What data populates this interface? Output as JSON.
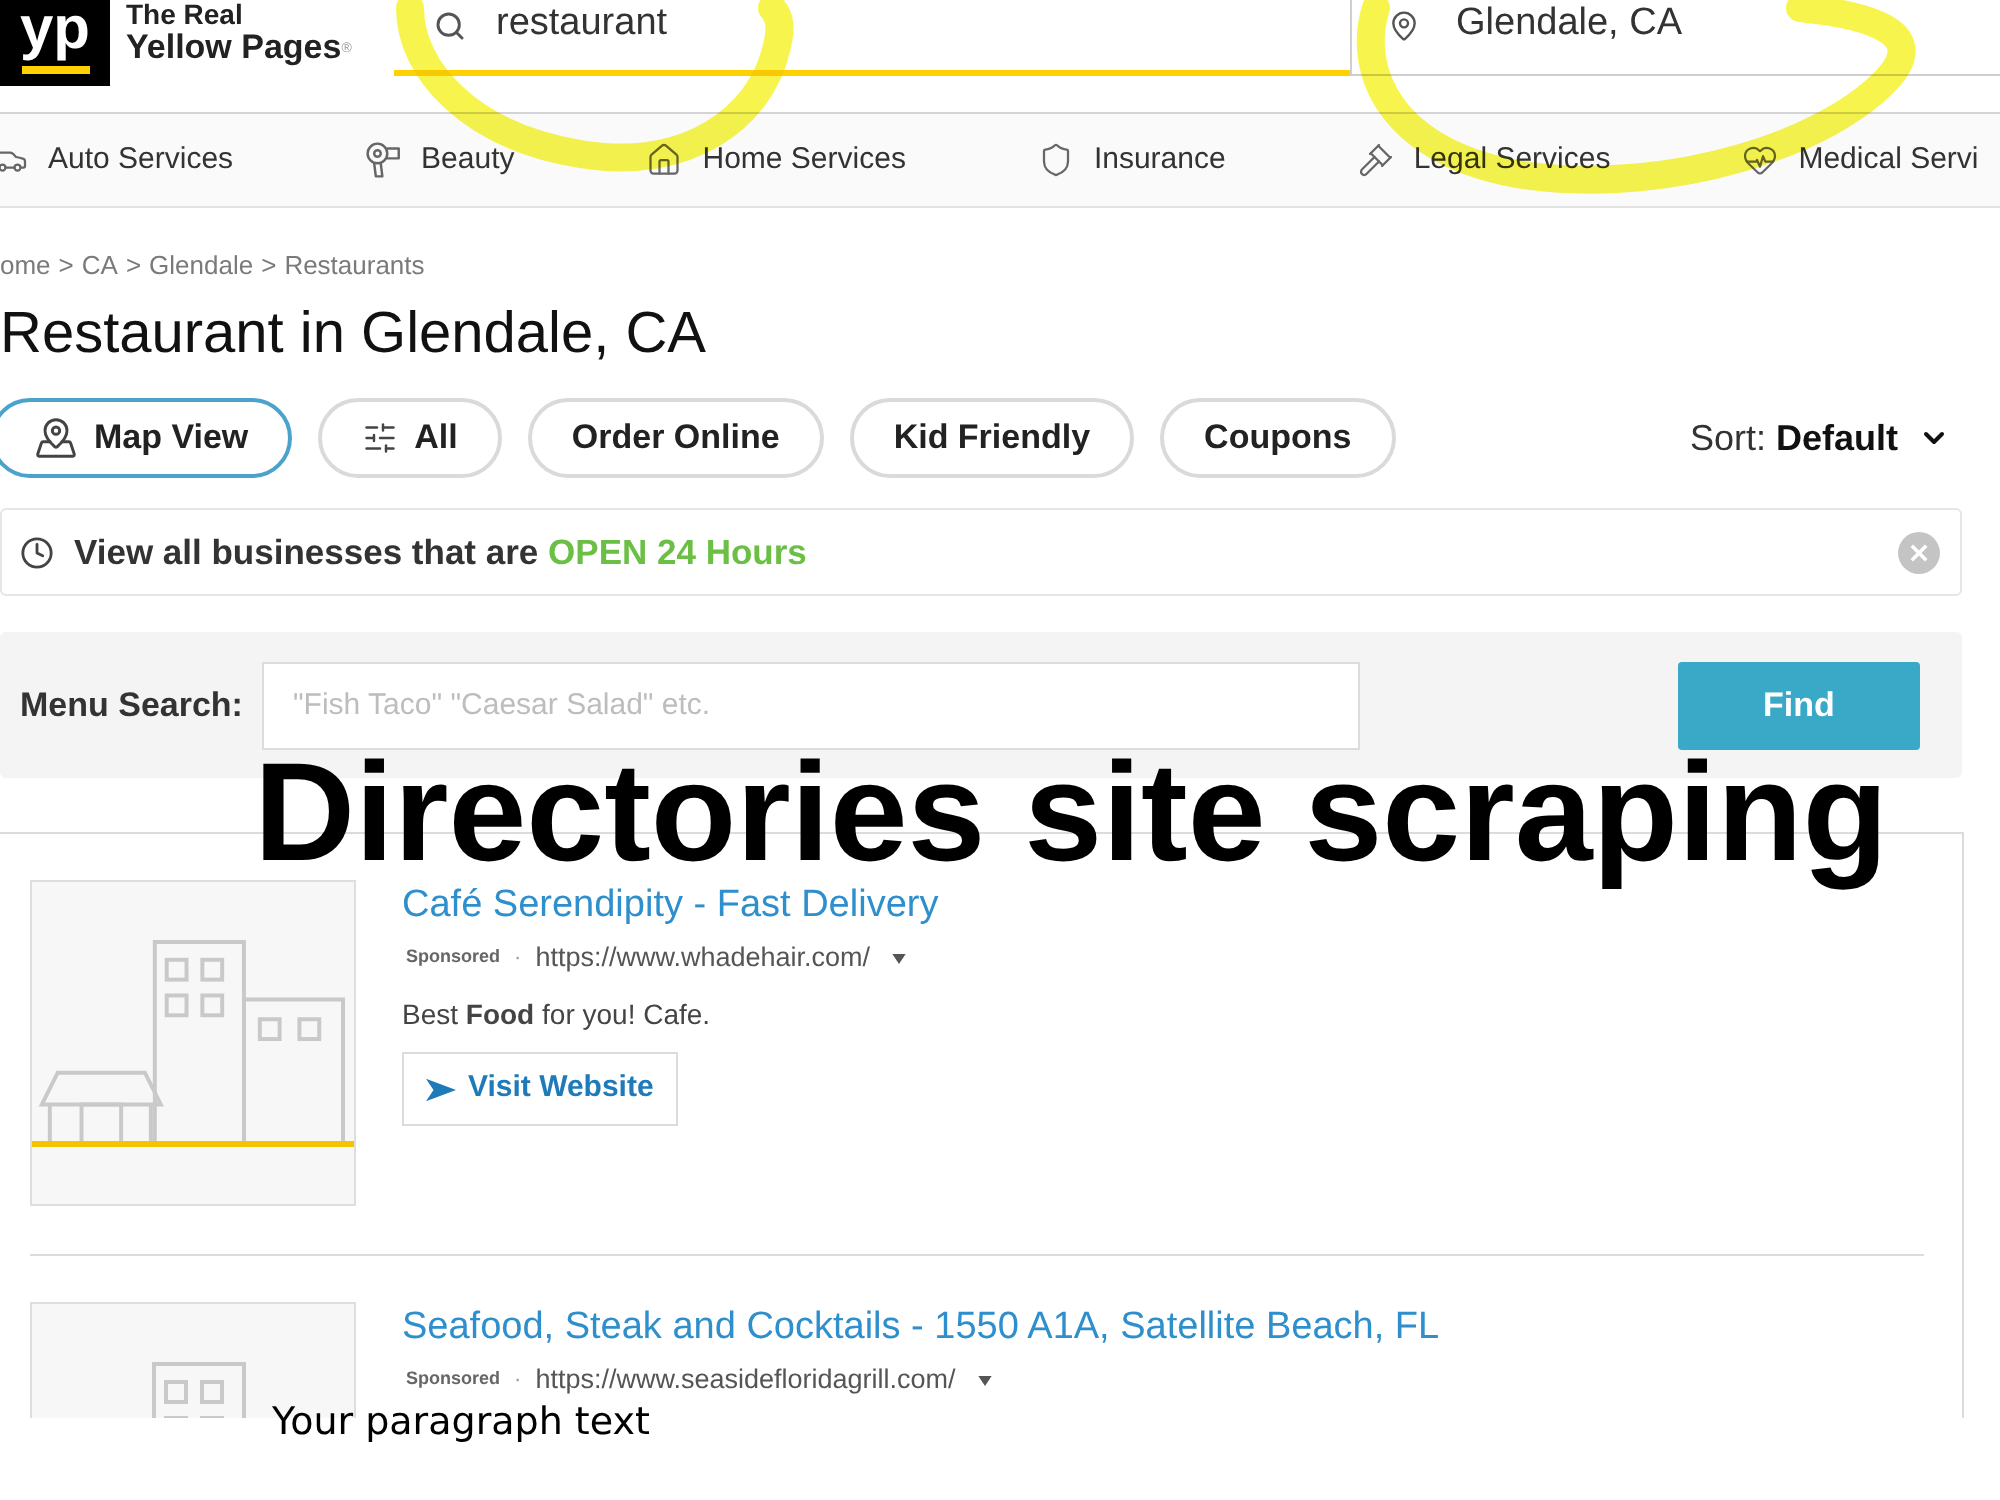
{
  "header": {
    "logo": {
      "mark": "yp",
      "line_1": "The Real",
      "line_2": "Yellow Pages$^{®}$"
    },
    "search": {
      "value": "restaurant",
      "highlighted": true
    },
    "location": {
      "value": "Glendale, CA",
      "highlighted": true
    }
  },
  "categories": [
    {
      "kind": "auto",
      "label": "Auto Services"
    },
    {
      "kind": "beauty",
      "label": "Beauty"
    },
    {
      "kind": "home",
      "label": "Home Services"
    },
    {
      "kind": "insurance",
      "label": "Insurance"
    },
    {
      "kind": "legal",
      "label": "Legal Services"
    },
    {
      "kind": "medical",
      "label": "Medical Servi"
    }
  ],
  "breadcrumbs": {
    "separator": ">",
    "items": [
      "ome",
      "CA",
      "Glendale",
      "Restaurants"
    ]
  },
  "title": "Restaurant in Glendale, CA",
  "filters": [
    {
      "kind": "map",
      "label": "Map View",
      "selected": true
    },
    {
      "kind": "filter",
      "label": "All",
      "selected": false
    },
    {
      "kind": "plain",
      "label": "Order Online",
      "selected": false
    },
    {
      "kind": "plain",
      "label": "Kid Friendly",
      "selected": false
    },
    {
      "kind": "plain",
      "label": "Coupons",
      "selected": false
    }
  ],
  "sort": {
    "label": "Sort:",
    "value": "Default"
  },
  "open_banner": {
    "text": "View all businesses that are",
    "link": "OPEN 24 Hours"
  },
  "menu_search": {
    "label": "Menu Search:",
    "placeholder": "\"Fish Taco\" \"Caesar Salad\" etc.",
    "button": "Find"
  },
  "results": [
    {
      "title": "Café Serendipity - Fast Delivery",
      "badge": "Sponsored",
      "separator": "·",
      "url": "https://www.whadehair.com/",
      "description": "Best **Food** for you! Cafe.",
      "button": "Visit Website"
    },
    {
      "title": "Seafood, Steak and Cocktails - 1550 A1A, Satellite Beach, FL",
      "badge": "Sponsored",
      "separator": "·",
      "url": "https://www.seasidefloridagrill.com/"
    }
  ],
  "overlay": {
    "headline": "Directories site scraping",
    "caption": "Your paragraph text"
  }
}
